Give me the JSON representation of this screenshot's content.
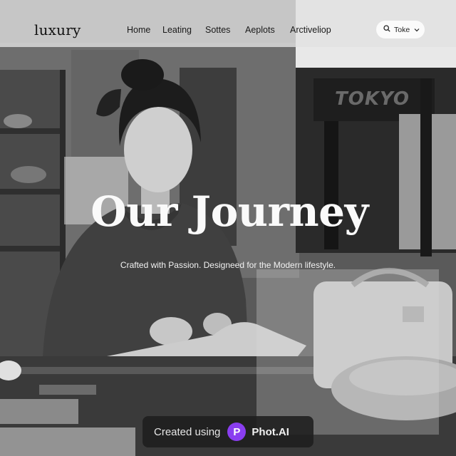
{
  "header": {
    "logo": "luxury",
    "nav": [
      "Home",
      "Leating",
      "Sottes",
      "Aeplots",
      "Arctiveliop"
    ],
    "search": {
      "label": "Toke"
    }
  },
  "hero": {
    "title": "Our Journey",
    "subtitle": "Crafted with Passion. Designeed for the Modern lifestyle."
  },
  "background": {
    "sign_text": "TOKYO"
  },
  "watermark": {
    "text": "Created using",
    "logo_letter": "P",
    "brand": "Phot.AI"
  },
  "colors": {
    "watermark_accent": "#8a3ef0",
    "nav_bar": "#e1e1e1"
  }
}
